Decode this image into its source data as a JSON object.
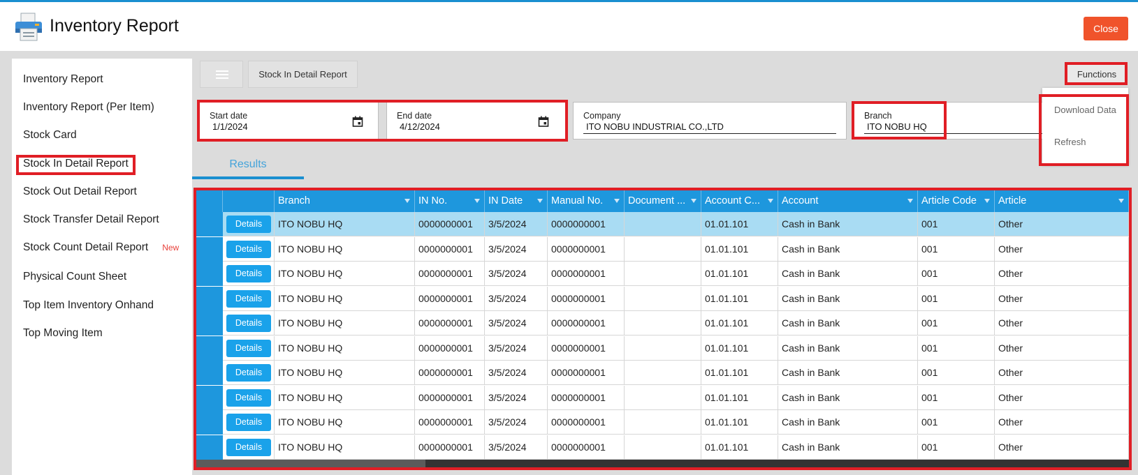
{
  "app": {
    "title": "Inventory Report",
    "close_label": "Close",
    "icon": "printer-icon"
  },
  "sidebar": {
    "items": [
      {
        "label": "Inventory Report"
      },
      {
        "label": "Inventory Report (Per Item)"
      },
      {
        "label": "Stock Card"
      },
      {
        "label": "Stock In Detail Report",
        "active": true
      },
      {
        "label": "Stock Out Detail Report"
      },
      {
        "label": "Stock Transfer Detail Report"
      },
      {
        "label": "Stock Count Detail Report",
        "badge": "New"
      },
      {
        "label": "Physical Count Sheet"
      },
      {
        "label": "Top Item Inventory Onhand"
      },
      {
        "label": "Top Moving Item"
      }
    ]
  },
  "toolbar": {
    "menu_icon": "hamburger-icon",
    "report_label": "Stock In Detail Report",
    "functions_label": "Functions"
  },
  "functions_menu": {
    "items": [
      {
        "label": "Download Data"
      },
      {
        "label": "Refresh"
      }
    ]
  },
  "filters": {
    "start_date": {
      "label": "Start date",
      "value": "1/1/2024",
      "icon": "calendar-icon"
    },
    "end_date": {
      "label": "End date",
      "value": "4/12/2024",
      "icon": "calendar-icon"
    },
    "company": {
      "label": "Company",
      "value": "ITO NOBU INDUSTRIAL CO.,LTD"
    },
    "branch": {
      "label": "Branch",
      "value": "ITO NOBU HQ"
    }
  },
  "tabs": {
    "results_label": "Results"
  },
  "grid": {
    "columns": [
      "Branch",
      "IN No.",
      "IN Date",
      "Manual No.",
      "Document ...",
      "Account C...",
      "Account",
      "Article Code",
      "Article"
    ],
    "details_label": "Details",
    "rows": [
      {
        "branch": "ITO NOBU HQ",
        "in_no": "0000000001",
        "in_date": "3/5/2024",
        "manual_no": "0000000001",
        "document": "",
        "account_code": "01.01.101",
        "account": "Cash in Bank",
        "article_code": "001",
        "article": "Other",
        "selected": true
      },
      {
        "branch": "ITO NOBU HQ",
        "in_no": "0000000001",
        "in_date": "3/5/2024",
        "manual_no": "0000000001",
        "document": "",
        "account_code": "01.01.101",
        "account": "Cash in Bank",
        "article_code": "001",
        "article": "Other"
      },
      {
        "branch": "ITO NOBU HQ",
        "in_no": "0000000001",
        "in_date": "3/5/2024",
        "manual_no": "0000000001",
        "document": "",
        "account_code": "01.01.101",
        "account": "Cash in Bank",
        "article_code": "001",
        "article": "Other"
      },
      {
        "branch": "ITO NOBU HQ",
        "in_no": "0000000001",
        "in_date": "3/5/2024",
        "manual_no": "0000000001",
        "document": "",
        "account_code": "01.01.101",
        "account": "Cash in Bank",
        "article_code": "001",
        "article": "Other"
      },
      {
        "branch": "ITO NOBU HQ",
        "in_no": "0000000001",
        "in_date": "3/5/2024",
        "manual_no": "0000000001",
        "document": "",
        "account_code": "01.01.101",
        "account": "Cash in Bank",
        "article_code": "001",
        "article": "Other"
      },
      {
        "branch": "ITO NOBU HQ",
        "in_no": "0000000001",
        "in_date": "3/5/2024",
        "manual_no": "0000000001",
        "document": "",
        "account_code": "01.01.101",
        "account": "Cash in Bank",
        "article_code": "001",
        "article": "Other"
      },
      {
        "branch": "ITO NOBU HQ",
        "in_no": "0000000001",
        "in_date": "3/5/2024",
        "manual_no": "0000000001",
        "document": "",
        "account_code": "01.01.101",
        "account": "Cash in Bank",
        "article_code": "001",
        "article": "Other"
      },
      {
        "branch": "ITO NOBU HQ",
        "in_no": "0000000001",
        "in_date": "3/5/2024",
        "manual_no": "0000000001",
        "document": "",
        "account_code": "01.01.101",
        "account": "Cash in Bank",
        "article_code": "001",
        "article": "Other"
      },
      {
        "branch": "ITO NOBU HQ",
        "in_no": "0000000001",
        "in_date": "3/5/2024",
        "manual_no": "0000000001",
        "document": "",
        "account_code": "01.01.101",
        "account": "Cash in Bank",
        "article_code": "001",
        "article": "Other"
      },
      {
        "branch": "ITO NOBU HQ",
        "in_no": "0000000001",
        "in_date": "3/5/2024",
        "manual_no": "0000000001",
        "document": "",
        "account_code": "01.01.101",
        "account": "Cash in Bank",
        "article_code": "001",
        "article": "Other"
      }
    ]
  },
  "colors": {
    "accent": "#1e97dd",
    "close_button": "#f0532b",
    "highlight": "#e01e25",
    "selected_row": "#a9dcf3",
    "badge_new": "#e8403a"
  }
}
